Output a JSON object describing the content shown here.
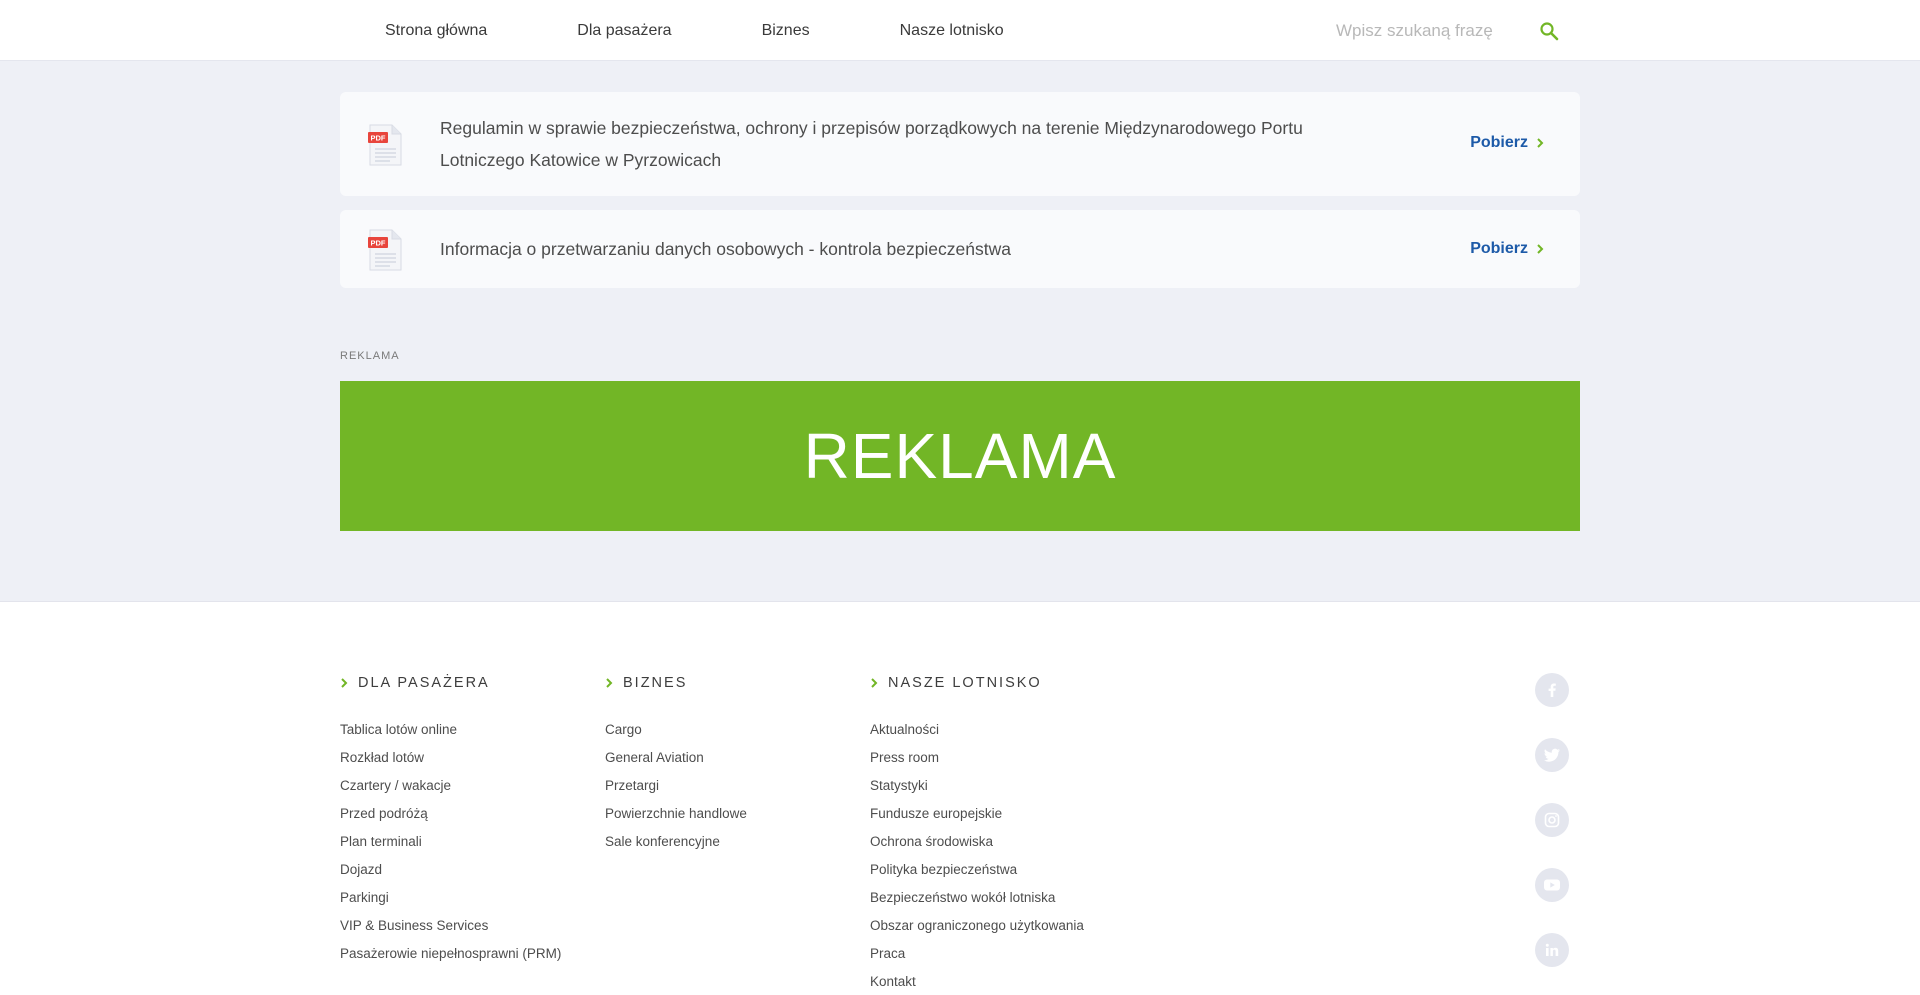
{
  "nav": {
    "items": [
      "Strona główna",
      "Dla pasażera",
      "Biznes",
      "Nasze lotnisko"
    ],
    "search_placeholder": "Wpisz szukaną frazę"
  },
  "documents": [
    {
      "icon_label": "PDF",
      "title": "Regulamin w sprawie bezpieczeństwa, ochrony i przepisów porządkowych na terenie Międzynarodowego Portu Lotniczego Katowice w Pyrzowicach",
      "action": "Pobierz"
    },
    {
      "icon_label": "PDF",
      "title": "Informacja o przetwarzaniu danych osobowych - kontrola bezpieczeństwa",
      "action": "Pobierz"
    }
  ],
  "ad": {
    "label": "REKLAMA",
    "banner_text": "REKLAMA",
    "banner_color": "#72b626"
  },
  "footer": {
    "columns": [
      {
        "heading": "DLA PASAŻERA",
        "links": [
          "Tablica lotów online",
          "Rozkład lotów",
          "Czartery / wakacje",
          "Przed podróżą",
          "Plan terminali",
          "Dojazd",
          "Parkingi",
          "VIP & Business Services",
          "Pasażerowie niepełnosprawni (PRM)"
        ]
      },
      {
        "heading": "BIZNES",
        "links": [
          "Cargo",
          "General Aviation",
          "Przetargi",
          "Powierzchnie handlowe",
          "Sale konferencyjne"
        ]
      },
      {
        "heading": "NASZE LOTNISKO",
        "links": [
          "Aktualności",
          "Press room",
          "Statystyki",
          "Fundusze europejskie",
          "Ochrona środowiska",
          "Polityka bezpieczeństwa",
          "Bezpieczeństwo wokół lotniska",
          "Obszar ograniczonego użytkowania",
          "Praca",
          "Kontakt"
        ]
      }
    ],
    "social": [
      "facebook-icon",
      "twitter-icon",
      "instagram-icon",
      "youtube-icon",
      "linkedin-icon"
    ]
  },
  "colors": {
    "accent_green": "#72b626",
    "link_blue": "#1d5aa8",
    "pdf_red": "#e8453c"
  }
}
